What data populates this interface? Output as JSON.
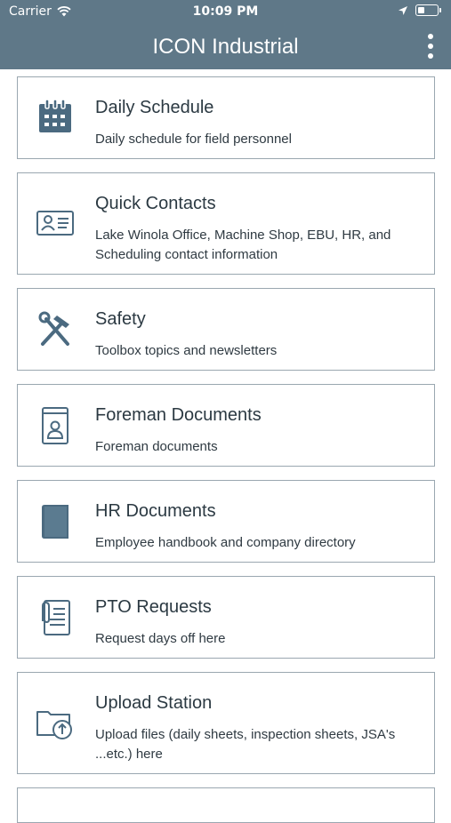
{
  "status_bar": {
    "carrier": "Carrier",
    "time": "10:09 PM"
  },
  "header": {
    "title": "ICON Industrial"
  },
  "colors": {
    "header_bg": "#5f7888",
    "icon": "#4b6a80",
    "card_border": "#9aa7b0"
  },
  "menu": {
    "items": [
      {
        "icon": "calendar-icon",
        "title": "Daily Schedule",
        "description": "Daily schedule for field personnel"
      },
      {
        "icon": "contact-card-icon",
        "title": "Quick Contacts",
        "description": "Lake Winola Office, Machine Shop, EBU, HR, and Scheduling contact information"
      },
      {
        "icon": "tools-icon",
        "title": "Safety",
        "description": "Toolbox topics and newsletters"
      },
      {
        "icon": "person-document-icon",
        "title": "Foreman Documents",
        "description": "Foreman documents"
      },
      {
        "icon": "book-icon",
        "title": "HR Documents",
        "description": "Employee handbook and company directory"
      },
      {
        "icon": "paperclip-document-icon",
        "title": "PTO Requests",
        "description": "Request days off here"
      },
      {
        "icon": "folder-upload-icon",
        "title": "Upload Station",
        "description": "Upload files (daily sheets, inspection sheets, JSA's ...etc.) here"
      }
    ]
  }
}
